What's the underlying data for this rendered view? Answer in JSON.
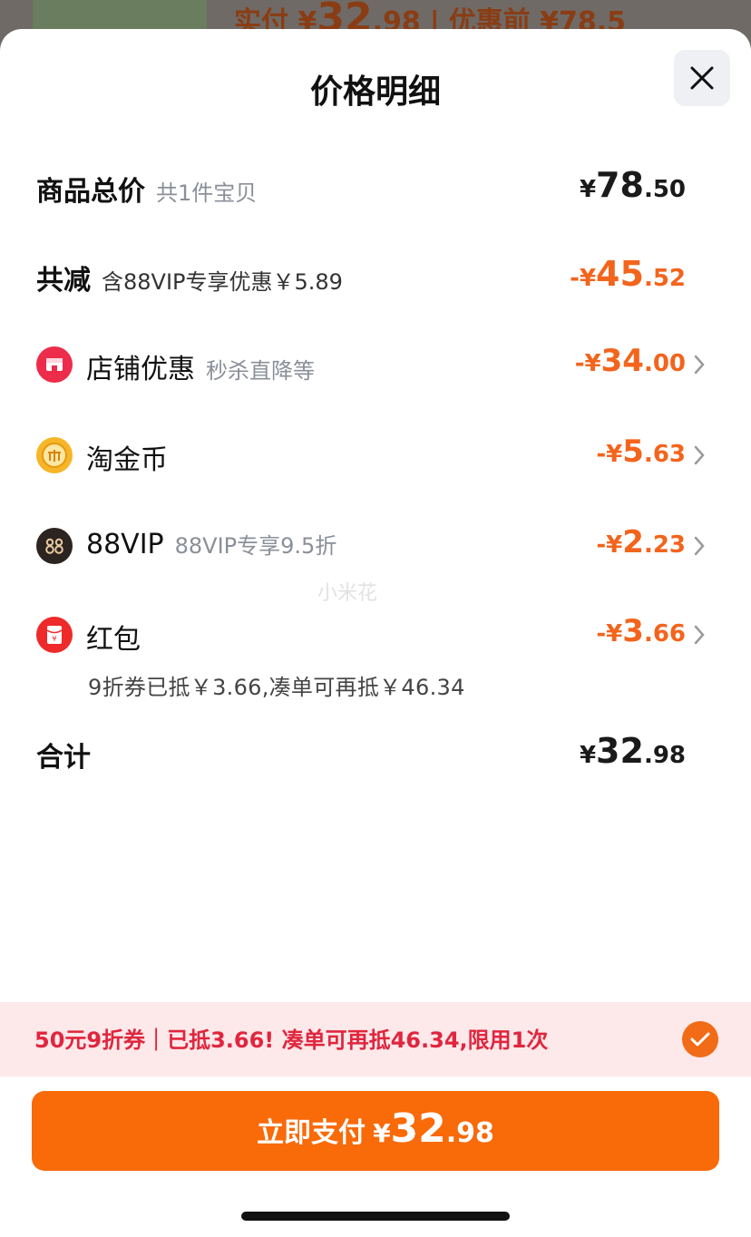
{
  "background": {
    "price_prefix": "实付 ¥",
    "price_int": "32",
    "price_dec": ".98",
    "separator": "|",
    "before_discount": "优惠前 ¥78.5"
  },
  "header": {
    "title": "价格明细"
  },
  "total_goods": {
    "label": "商品总价",
    "sub": "共1件宝贝",
    "currency": "¥",
    "int": "78",
    "dec": ".50"
  },
  "total_reduction": {
    "label": "共减",
    "sub": "含88VIP专享优惠￥5.89",
    "sign_currency": "-¥",
    "int": "45",
    "dec": ".52"
  },
  "discounts": [
    {
      "label": "店铺优惠",
      "sub": "秒杀直降等",
      "sign_currency": "-¥",
      "int": "34",
      "dec": ".00",
      "icon": "store-icon"
    },
    {
      "label": "淘金币",
      "sub": "",
      "sign_currency": "-¥",
      "int": "5",
      "dec": ".63",
      "icon": "gold-coin-icon"
    },
    {
      "label": "88VIP",
      "sub": "88VIP专享9.5折",
      "sign_currency": "-¥",
      "int": "2",
      "dec": ".23",
      "icon": "vip88-icon"
    },
    {
      "label": "红包",
      "sub": "",
      "sign_currency": "-¥",
      "int": "3",
      "dec": ".66",
      "icon": "red-envelope-icon"
    }
  ],
  "red_envelope_note": "9折券已抵￥3.66,凑单可再抵￥46.34",
  "grand_total": {
    "label": "合计",
    "currency": "¥",
    "int": "32",
    "dec": ".98"
  },
  "watermark": "小米花",
  "coupon_bar": {
    "text": "50元9折券｜已抵3.66! 凑单可再抵46.34,限用1次",
    "checked": true
  },
  "pay_button": {
    "label": "立即支付",
    "currency": "¥",
    "int": "32",
    "dec": ".98"
  },
  "colors": {
    "accent": "#f96a09",
    "discount_text": "#f3641c",
    "coupon_bg": "#fde8ea",
    "coupon_text": "#e0263e"
  }
}
